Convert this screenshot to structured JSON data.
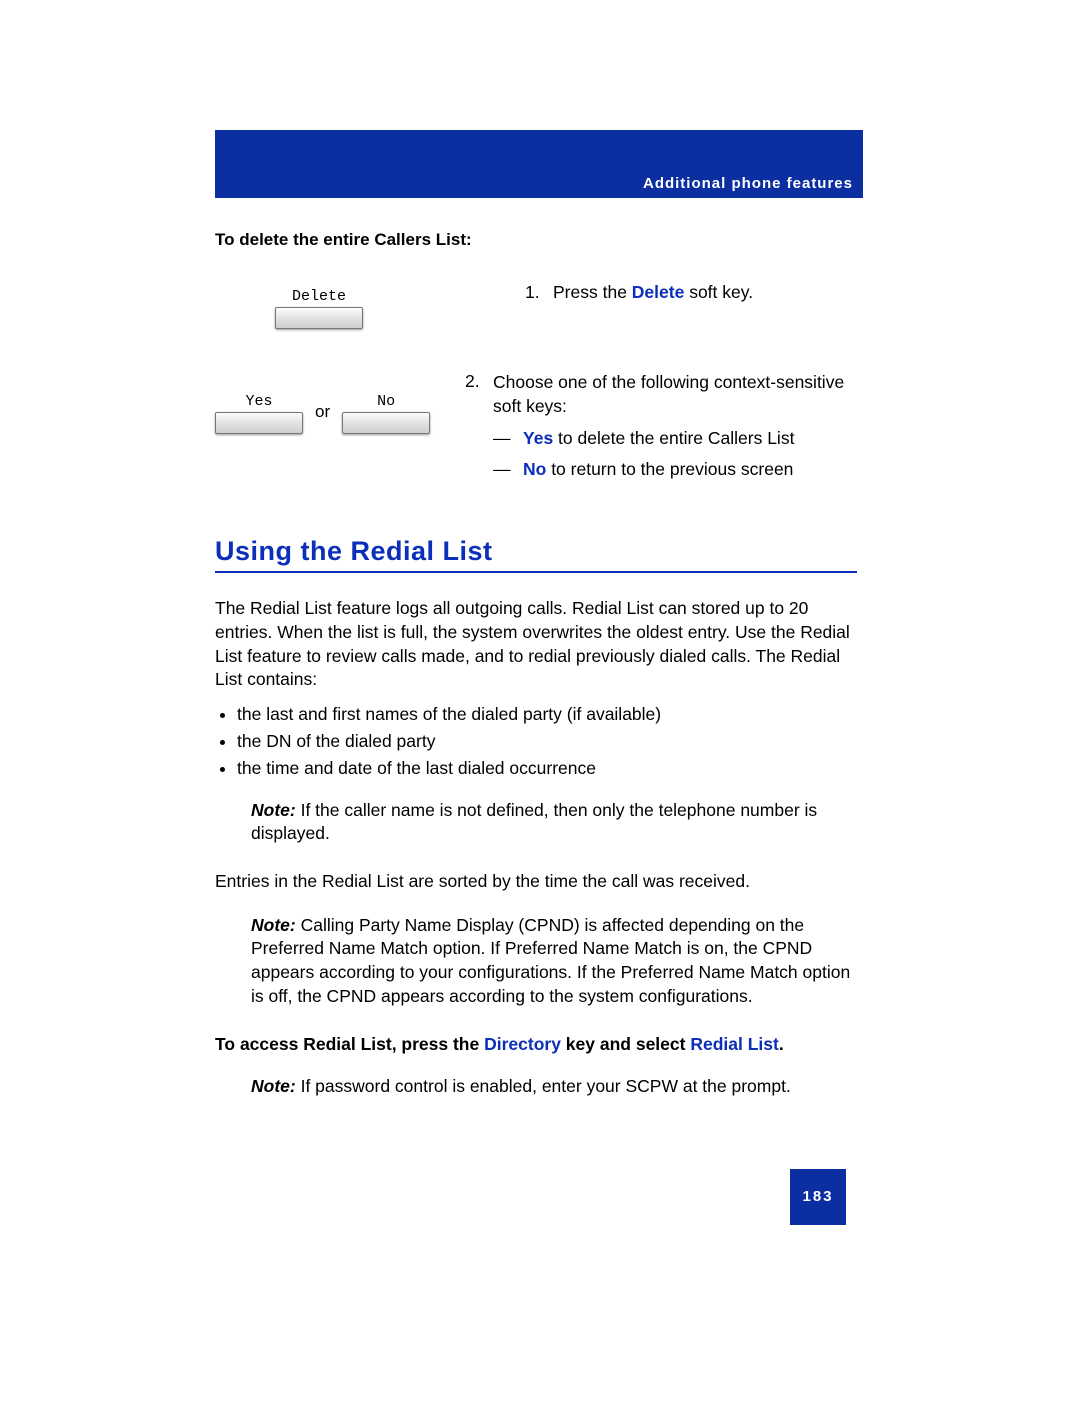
{
  "header": {
    "section": "Additional phone features"
  },
  "delete_section": {
    "heading": "To delete the entire Callers List:",
    "step1": {
      "num": "1.",
      "pre": "Press the ",
      "kw": "Delete",
      "post": " soft key.",
      "key_label": "Delete"
    },
    "step2": {
      "num": "2.",
      "intro": "Choose one of the following context-sensitive soft keys:",
      "key_yes": "Yes",
      "key_no": "No",
      "or": "or",
      "opt_yes": {
        "kw": "Yes",
        "post": " to delete the entire Callers List"
      },
      "opt_no": {
        "kw": "No",
        "post": " to return to the previous screen"
      },
      "dash": "—"
    }
  },
  "redial": {
    "heading": "Using the Redial List",
    "intro": "The Redial List feature logs all outgoing calls. Redial List can stored up to 20 entries. When the list is full, the system overwrites the oldest entry. Use the Redial List feature to review calls made, and to redial previously dialed calls. The Redial List contains:",
    "bullets": [
      "the last and first names of the dialed party (if available)",
      "the DN of the dialed party",
      "the time and date of the last dialed occurrence"
    ],
    "note1": {
      "label": "Note:",
      "text": " If the caller name is not defined, then only the telephone number is displayed."
    },
    "sorted": "Entries in the Redial List are sorted by the time the call was received.",
    "note2": {
      "label": "Note:",
      "text": " Calling Party Name Display (CPND) is affected depending on the Preferred Name Match option. If Preferred Name Match is on, the CPND appears according to your configurations. If the Preferred Name Match option is off, the CPND appears according to the system configurations."
    },
    "access": {
      "pre": "To access Redial List, press the ",
      "kw1": "Directory",
      "mid": " key and select ",
      "kw2": "Redial List",
      "post": "."
    },
    "note3": {
      "label": "Note:",
      "text": " If password control is enabled, enter your SCPW at the prompt."
    }
  },
  "page_number": "183"
}
